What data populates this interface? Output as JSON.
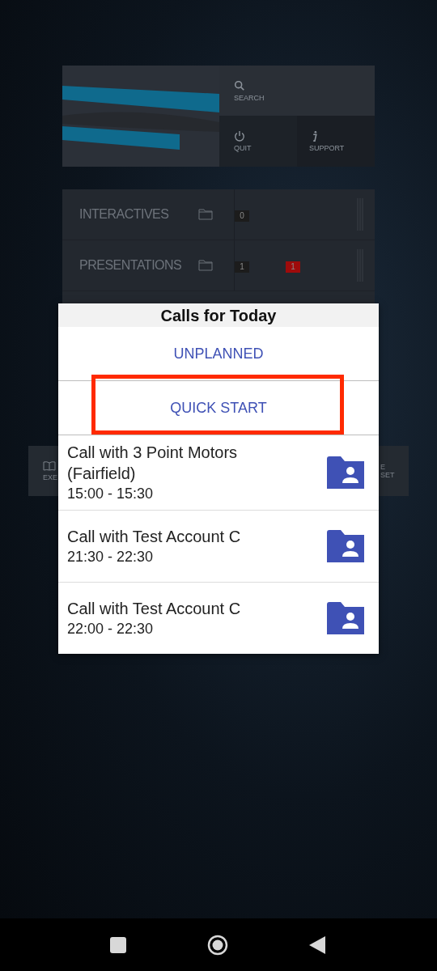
{
  "menu": {
    "search": "SEARCH",
    "quit": "QUIT",
    "support": "SUPPORT"
  },
  "categories": [
    {
      "label": "INTERACTIVES",
      "counts": [
        {
          "value": "0",
          "color": "#1c1c1c"
        }
      ]
    },
    {
      "label": "PRESENTATIONS",
      "counts": [
        {
          "value": "1",
          "color": "#1c1c1c"
        },
        {
          "value": "1",
          "color": "#9e0b0b"
        }
      ]
    }
  ],
  "side_tiles": {
    "left": "EXE",
    "right": [
      "E",
      "SET"
    ]
  },
  "dialog": {
    "title": "Calls for Today",
    "actions": [
      {
        "label": "UNPLANNED",
        "highlighted": false
      },
      {
        "label": "QUICK START",
        "highlighted": true
      }
    ],
    "calls": [
      {
        "title": "Call with 3 Point Motors (Fairfield)",
        "time": "15:00 - 15:30"
      },
      {
        "title": "Call with Test Account C",
        "time": "21:30 - 22:30"
      },
      {
        "title": "Call with Test Account C",
        "time": "22:00 - 22:30"
      }
    ]
  }
}
